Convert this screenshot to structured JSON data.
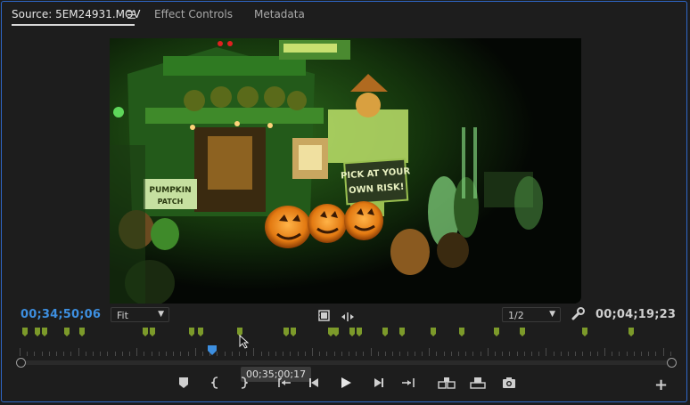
{
  "tabs": [
    {
      "label": "Source: 5EM24931.MOV",
      "active": true
    },
    {
      "label": "Effect Controls",
      "active": false
    },
    {
      "label": "Metadata",
      "active": false
    }
  ],
  "tab_menu_icon": "hamburger-menu-icon",
  "video": {
    "signs": {
      "pumpkin_patch": "PUMPKIN PATCH",
      "pick_at_your_own_risk": "PICK AT YOUR OWN RISK!"
    }
  },
  "timecode": {
    "current": "00;34;50;06",
    "duration": "00;04;19;23"
  },
  "zoom": {
    "value": "Fit"
  },
  "resolution": {
    "value": "1/2"
  },
  "icons": {
    "export_frame_settings": "filmstrip-icon",
    "compare": "arrows-icon",
    "settings": "wrench-icon"
  },
  "tooltip": {
    "text": "00;35;00;17"
  },
  "transport": [
    {
      "name": "add-marker-button",
      "icon": "marker-icon"
    },
    {
      "name": "mark-in-button",
      "icon": "mark-in-icon"
    },
    {
      "name": "mark-out-button",
      "icon": "mark-out-icon"
    },
    {
      "name": "go-to-in-button",
      "icon": "go-to-in-icon"
    },
    {
      "name": "step-back-button",
      "icon": "step-back-icon"
    },
    {
      "name": "play-button",
      "icon": "play-icon"
    },
    {
      "name": "step-forward-button",
      "icon": "step-forward-icon"
    },
    {
      "name": "go-to-out-button",
      "icon": "go-to-out-icon"
    },
    {
      "name": "insert-button",
      "icon": "insert-icon"
    },
    {
      "name": "overwrite-button",
      "icon": "overwrite-icon"
    },
    {
      "name": "export-frame-button",
      "icon": "camera-icon"
    },
    {
      "name": "button-editor",
      "icon": "plus-icon"
    }
  ],
  "colors": {
    "accent": "#3d8fe0",
    "marker": "#7c9a2a",
    "panel_border": "#2e67c7"
  }
}
